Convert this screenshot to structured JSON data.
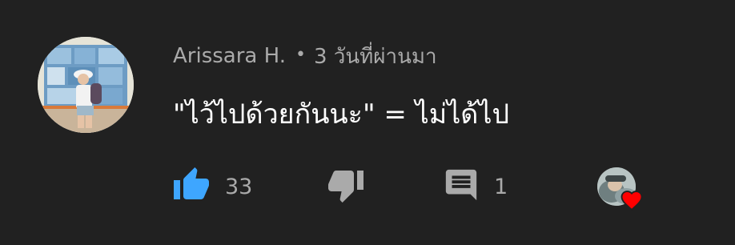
{
  "comment": {
    "author": "Arissara H.",
    "separator": "•",
    "time_ago": "3 วันที่ผ่านมา",
    "text": "\"ไว้ไปด้วยกันนะ\" = ไม่ได้ไป"
  },
  "actions": {
    "like_count": "33",
    "reply_count": "1"
  },
  "icons": {
    "like": "thumbs-up-icon",
    "dislike": "thumbs-down-icon",
    "reply": "comment-icon",
    "hearted": "heart-icon"
  },
  "colors": {
    "background": "#212121",
    "like_active": "#3ea6ff",
    "icon_grey": "#aaaaaa",
    "heart": "#ff0000"
  }
}
